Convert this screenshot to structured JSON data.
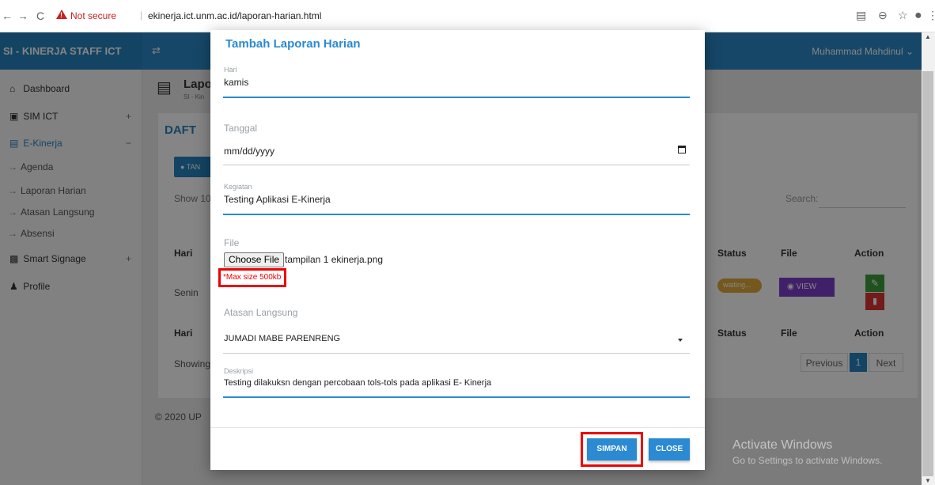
{
  "browser": {
    "nav_back": "←",
    "nav_forward": "→",
    "nav_reload": "C",
    "security_label": "Not secure",
    "separator": "|",
    "url": "ekinerja.ict.unm.ac.id/laporan-harian.html"
  },
  "topnav": {
    "brand": "SI - KINERJA STAFF ICT",
    "user": "Muhammad Mahdinul"
  },
  "sidebar": {
    "items": [
      {
        "label": "Dashboard",
        "icon": "home-icon"
      },
      {
        "label": "SIM ICT",
        "icon": "id-card-icon",
        "toggle": "+"
      },
      {
        "label": "E-Kinerja",
        "icon": "clipboard-icon",
        "toggle": "−"
      },
      {
        "label": "Agenda",
        "icon": "arrow-right-icon"
      },
      {
        "label": "Laporan Harian",
        "icon": "arrow-right-icon"
      },
      {
        "label": "Atasan Langsung",
        "icon": "arrow-right-icon"
      },
      {
        "label": "Absensi",
        "icon": "arrow-right-icon"
      },
      {
        "label": "Smart Signage",
        "icon": "signage-icon",
        "toggle": "+"
      },
      {
        "label": "Profile",
        "icon": "user-icon"
      }
    ]
  },
  "content": {
    "title": "Lapo",
    "subtitle": "SI - Kin",
    "section_title": "DAFT",
    "add_button": "TAN",
    "show_label": "Show 10",
    "search_label": "Search:",
    "table": {
      "headers": [
        "Hari",
        "Status",
        "File",
        "Action"
      ],
      "row_day": "Senin",
      "row_status": "waiting...",
      "view_label": "VIEW"
    },
    "showing": "Showing",
    "pagination": {
      "previous": "Previous",
      "page": "1",
      "next": "Next"
    },
    "footer": "© 2020 UP"
  },
  "modal": {
    "title": "Tambah Laporan Harian",
    "fields": {
      "hari": {
        "label": "Hari",
        "value": "kamis"
      },
      "tanggal": {
        "label": "Tanggal",
        "value": "mm/dd/yyyy"
      },
      "kegiatan": {
        "label": "Kegiatan",
        "value": "Testing Aplikasi E-Kinerja"
      },
      "file": {
        "label": "File",
        "button": "Choose File",
        "filename": "tampilan 1 ekinerja.png",
        "note": "*Max size 500kb"
      },
      "atasan": {
        "label": "Atasan Langsung",
        "value": "JUMADI MABE PARENRENG"
      },
      "deskripsi": {
        "label": "Deskripsi",
        "value": "Testing dilakuksn dengan percobaan tols-tols pada aplikasi E- Kinerja"
      }
    },
    "buttons": {
      "save": "SIMPAN",
      "close": "CLOSE"
    }
  },
  "watermark": {
    "line1": "Activate Windows",
    "line2": "Go to Settings to activate Windows."
  },
  "colors": {
    "accent": "#2b8ad1",
    "highlight": "#e00000"
  }
}
